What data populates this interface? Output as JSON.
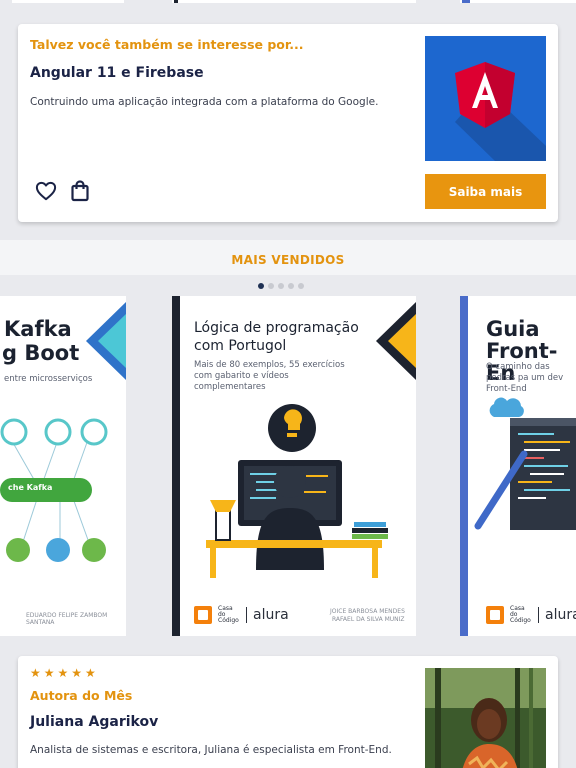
{
  "promo": {
    "eyebrow": "Talvez você também se interesse por...",
    "title": "Angular 11 e Firebase",
    "description": "Contruindo uma aplicação integrada com a plataforma do Google.",
    "cta_label": "Saiba mais",
    "thumb_icon": "angular-logo"
  },
  "bestsellers": {
    "heading": "MAIS VENDIDOS",
    "dots_total": 5,
    "active_dot": 1,
    "books": [
      {
        "title_line1": "Kafka",
        "title_line2": "g Boot",
        "subtitle": "entre microsserviços",
        "diagram_center_label": "che Kafka",
        "author_line": "EDUARDO FELIPE ZAMBOM SANTANA"
      },
      {
        "title": "Lógica de programação com Portugol",
        "subtitle": "Mais de 80 exemplos, 55 exercícios com gabarito e vídeos complementares",
        "authors_line1": "JOICE BARBOSA MENDES",
        "authors_line2": "RAFAEL DA SILVA MUNIZ",
        "publisher": "Casa do Código",
        "partner": "alura"
      },
      {
        "title_line1": "Guia",
        "title_line2": "Front-En",
        "subtitle": "O caminho das pedras pa um dev Front-End",
        "publisher": "Casa do Código",
        "partner": "alura"
      }
    ]
  },
  "author": {
    "stars": "★★★★★",
    "eyebrow": "Autora do Mês",
    "name": "Juliana Agarikov",
    "bio": "Analista de sistemas e escritora, Juliana é especialista em Front-End."
  },
  "colors": {
    "accent": "#e8950f",
    "navy": "#1b2346",
    "angular_red": "#dd0031",
    "thumb_blue": "#1d67cf"
  }
}
